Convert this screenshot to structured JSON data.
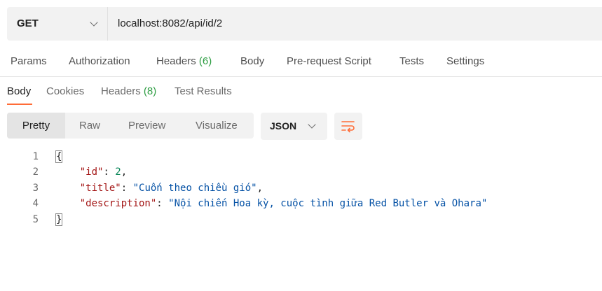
{
  "request": {
    "method": "GET",
    "url": "localhost:8082/api/id/2"
  },
  "request_tabs": [
    {
      "label": "Params",
      "count": ""
    },
    {
      "label": "Authorization",
      "count": ""
    },
    {
      "label": "Headers",
      "count": "(6)"
    },
    {
      "label": "Body",
      "count": ""
    },
    {
      "label": "Pre-request Script",
      "count": ""
    },
    {
      "label": "Tests",
      "count": ""
    },
    {
      "label": "Settings",
      "count": ""
    }
  ],
  "response_tabs": [
    {
      "label": "Body",
      "count": "",
      "active": true
    },
    {
      "label": "Cookies",
      "count": ""
    },
    {
      "label": "Headers",
      "count": "(8)"
    },
    {
      "label": "Test Results",
      "count": ""
    }
  ],
  "view_modes": [
    "Pretty",
    "Raw",
    "Preview",
    "Visualize"
  ],
  "active_view": "Pretty",
  "format": "JSON",
  "icons": {
    "wrap": "wrap-lines-icon",
    "chevron": "chevron-down-icon"
  },
  "colors": {
    "accent": "#ff6c37",
    "key": "#a31515",
    "string": "#0451a5",
    "number": "#098658",
    "count": "#2f9e44"
  },
  "code": {
    "line_numbers": [
      "1",
      "2",
      "3",
      "4",
      "5"
    ],
    "open_brace": "{",
    "close_brace": "}",
    "fields": [
      {
        "key": "\"id\"",
        "value": "2",
        "type": "number"
      },
      {
        "key": "\"title\"",
        "value": "\"Cuốn theo chiều gió\"",
        "type": "string"
      },
      {
        "key": "\"description\"",
        "value": "\"Nội chiến Hoa kỳ, cuộc tình giữa Red Butler và Ohara\"",
        "type": "string"
      }
    ]
  }
}
